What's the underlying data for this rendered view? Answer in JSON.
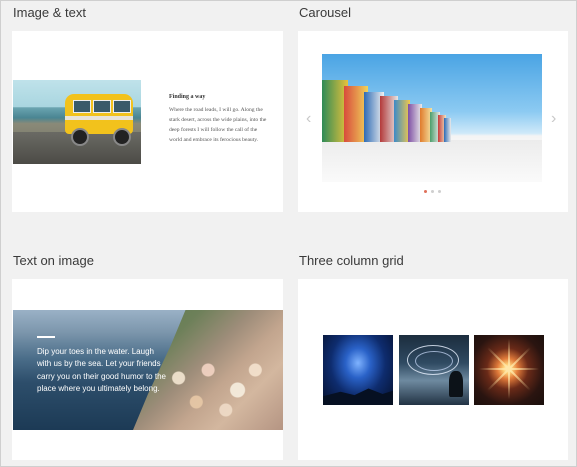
{
  "sections": {
    "image_text": {
      "title": "Image & text",
      "heading": "Finding a way",
      "body": "Where the road leads, I will go. Along the stark desert, across the wide plains, into the deep forests I will follow the call of the world and embrace its ferocious beauty."
    },
    "carousel": {
      "title": "Carousel",
      "prev_icon": "chevron-left-icon",
      "next_icon": "chevron-right-icon",
      "dots": 3,
      "active_dot": 0
    },
    "text_on_image": {
      "title": "Text on image",
      "body": "Dip your toes in the water. Laugh with us by the sea. Let your friends carry you on their good humor to the place where you ultimately belong."
    },
    "three_column_grid": {
      "title": "Three column grid"
    }
  },
  "colors": {
    "background": "#f1f1f1",
    "card": "#ffffff",
    "accent_dot": "#e0705a"
  }
}
